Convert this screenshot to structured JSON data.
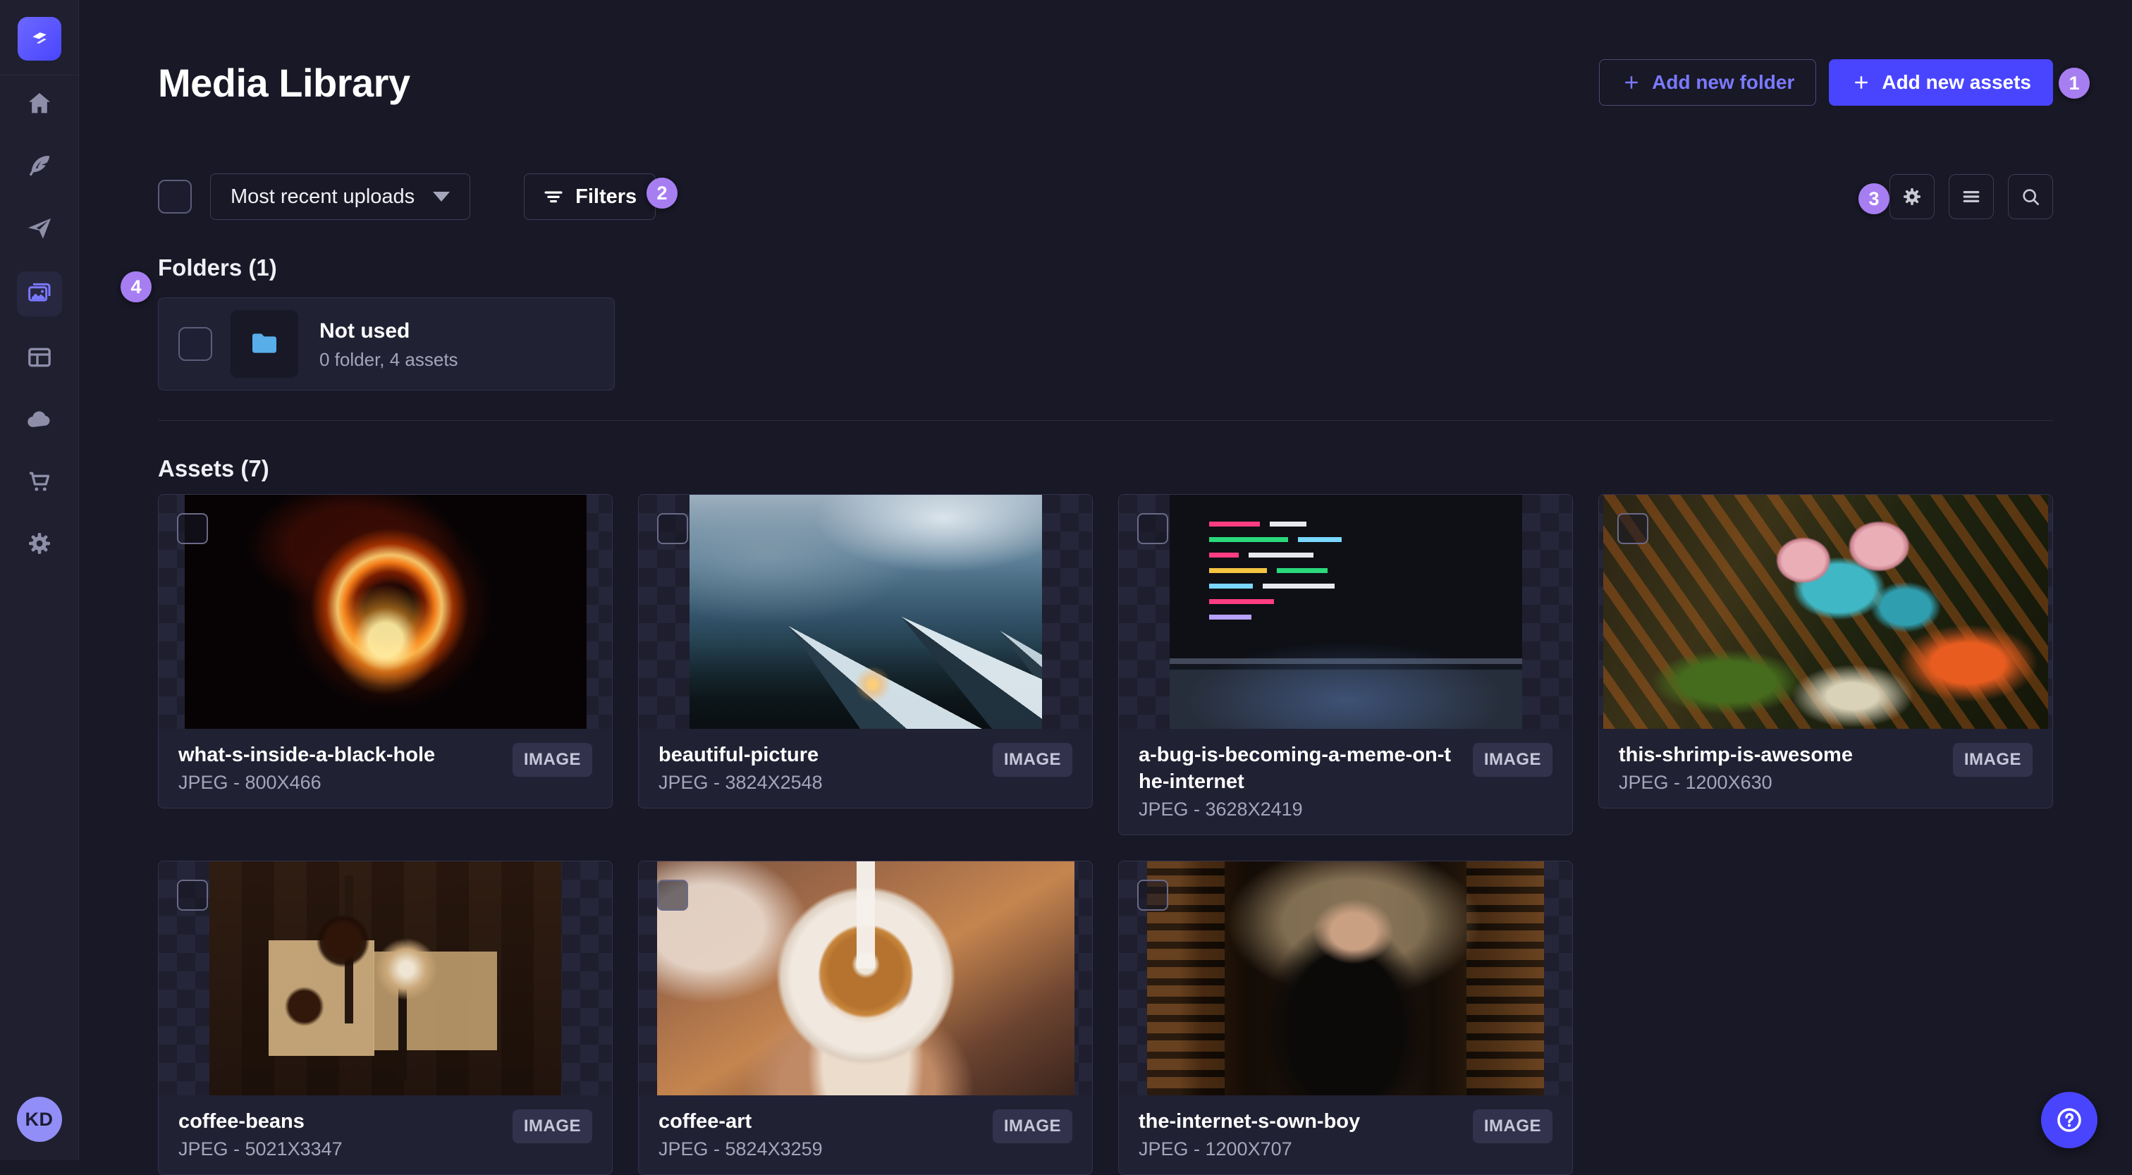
{
  "sidebar": {
    "logo_icon": "strapi-logo",
    "items": [
      {
        "icon": "home-icon",
        "active": false
      },
      {
        "icon": "content-manager-icon",
        "active": false
      },
      {
        "icon": "releases-icon",
        "active": false
      },
      {
        "icon": "media-library-icon",
        "active": true
      },
      {
        "icon": "content-type-builder-icon",
        "active": false
      },
      {
        "icon": "cloud-icon",
        "active": false
      },
      {
        "icon": "marketplace-icon",
        "active": false
      },
      {
        "icon": "settings-icon",
        "active": false
      }
    ],
    "user_initials": "KD"
  },
  "header": {
    "title": "Media Library",
    "add_new_folder": "Add new folder",
    "add_new_assets": "Add new assets"
  },
  "toolbar": {
    "sort_value": "Most recent uploads",
    "filters_label": "Filters",
    "icon_buttons": [
      "settings-icon",
      "list-view-icon",
      "search-icon"
    ]
  },
  "folders": {
    "heading": "Folders (1)",
    "items": [
      {
        "name": "Not used",
        "meta": "0 folder, 4 assets"
      }
    ]
  },
  "assets": {
    "heading": "Assets (7)",
    "items": [
      {
        "title": "what-s-inside-a-black-hole",
        "meta": "JPEG - 800X466",
        "badge": "IMAGE"
      },
      {
        "title": "beautiful-picture",
        "meta": "JPEG - 3824X2548",
        "badge": "IMAGE"
      },
      {
        "title": "a-bug-is-becoming-a-meme-on-the-internet",
        "meta": "JPEG - 3628X2419",
        "badge": "IMAGE"
      },
      {
        "title": "this-shrimp-is-awesome",
        "meta": "JPEG - 1200X630",
        "badge": "IMAGE"
      },
      {
        "title": "coffee-beans",
        "meta": "JPEG - 5021X3347",
        "badge": "IMAGE"
      },
      {
        "title": "coffee-art",
        "meta": "JPEG - 5824X3259",
        "badge": "IMAGE"
      },
      {
        "title": "the-internet-s-own-boy",
        "meta": "JPEG - 1200X707",
        "badge": "IMAGE"
      }
    ]
  },
  "annotations": {
    "marks": [
      "1",
      "2",
      "3",
      "4"
    ]
  },
  "fab": {
    "icon": "help-icon"
  },
  "colors": {
    "page_bg": "#181826",
    "card_bg": "#212134",
    "border": "#32324d",
    "accent": "#4945ff",
    "accent_text": "#7b79ff",
    "annotation": "#a77ef2",
    "folder_blue": "#58aee9",
    "avatar_bg": "#918ef7",
    "badge_bg": "#32324d",
    "text_secondary": "#a5a5ba"
  }
}
